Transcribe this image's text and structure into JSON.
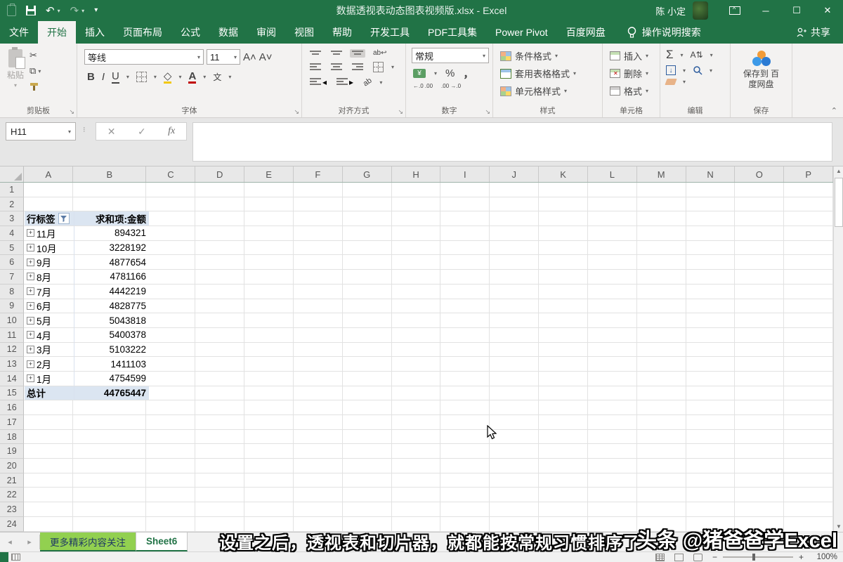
{
  "title_bar": {
    "title": "数据透视表动态图表视频版.xlsx  -  Excel",
    "user": "陈 小定"
  },
  "ribbon": {
    "tabs": [
      {
        "label": "文件"
      },
      {
        "label": "开始"
      },
      {
        "label": "插入"
      },
      {
        "label": "页面布局"
      },
      {
        "label": "公式"
      },
      {
        "label": "数据"
      },
      {
        "label": "审阅"
      },
      {
        "label": "视图"
      },
      {
        "label": "帮助"
      },
      {
        "label": "开发工具"
      },
      {
        "label": "PDF工具集"
      },
      {
        "label": "Power Pivot"
      },
      {
        "label": "百度网盘"
      }
    ],
    "active_tab": "开始",
    "search_label": "操作说明搜索",
    "share_label": "共享",
    "clipboard": {
      "label": "剪贴板",
      "paste": "粘贴"
    },
    "font": {
      "label": "字体",
      "font_name": "等线",
      "font_size": "11",
      "bold": "B",
      "italic": "I",
      "underline": "U",
      "pinyin": "文"
    },
    "alignment": {
      "label": "对齐方式",
      "wrap": "ab"
    },
    "number": {
      "label": "数字",
      "format": "常规",
      "percent": "%",
      "comma": "，",
      "currency": "¥",
      "inc_dec": "←.0 .00",
      "dec_dec": ".00 →.0"
    },
    "styles": {
      "label": "样式",
      "items": [
        "条件格式",
        "套用表格格式",
        "单元格样式"
      ]
    },
    "cells": {
      "label": "单元格",
      "items": [
        "插入",
        "删除",
        "格式"
      ]
    },
    "editing": {
      "label": "编辑",
      "autosum": "Σ"
    },
    "save": {
      "label": "保存",
      "button": "保存到 百度网盘"
    }
  },
  "formula_bar": {
    "name_box": "H11",
    "fx": "fx",
    "cancel": "✕",
    "enter": "✓"
  },
  "grid": {
    "columns": [
      "A",
      "B",
      "C",
      "D",
      "E",
      "F",
      "G",
      "H",
      "I",
      "J",
      "K",
      "L",
      "M",
      "N",
      "O",
      "P"
    ],
    "row_count": 24
  },
  "pivot": {
    "header": {
      "row_label": "行标签",
      "value_label": "求和项:金额"
    },
    "rows": [
      {
        "label": "11月",
        "value": "894321"
      },
      {
        "label": "10月",
        "value": "3228192"
      },
      {
        "label": "9月",
        "value": "4877654"
      },
      {
        "label": "8月",
        "value": "4781166"
      },
      {
        "label": "7月",
        "value": "4442219"
      },
      {
        "label": "6月",
        "value": "4828775"
      },
      {
        "label": "5月",
        "value": "5043818"
      },
      {
        "label": "4月",
        "value": "5400378"
      },
      {
        "label": "3月",
        "value": "5103222"
      },
      {
        "label": "2月",
        "value": "1411103"
      },
      {
        "label": "1月",
        "value": "4754599"
      }
    ],
    "total": {
      "label": "总计",
      "value": "44765447"
    }
  },
  "sheet_tabs": {
    "tabs": [
      {
        "label": "更多精彩内容关注",
        "style": "green"
      },
      {
        "label": "Sheet6",
        "style": "active"
      }
    ]
  },
  "overlay": {
    "subtitle": "设置之后，透视表和切片器，就都能按常规习惯排序了",
    "watermark": "头条 @猪爸爸学Excel"
  },
  "status_bar": {
    "zoom": "100%"
  },
  "colors": {
    "excel_green": "#217346",
    "pivot_fill": "#dbe5f1",
    "tab_green": "#92d050"
  }
}
